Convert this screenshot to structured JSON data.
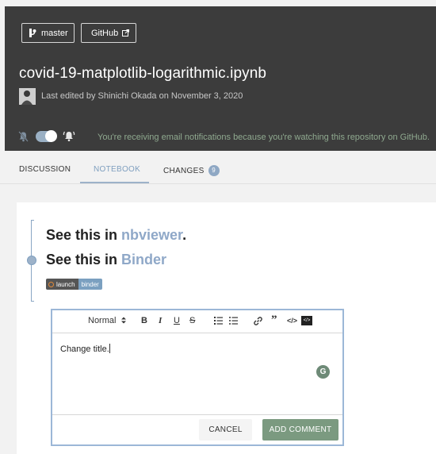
{
  "header": {
    "branch_label": "master",
    "github_label": "GitHub",
    "file_title": "covid-19-matplotlib-logarithmic.ipynb",
    "edit_meta": "Last edited by Shinichi Okada on November 3, 2020",
    "notification_text": "You're receiving email notifications because you're watching this repository on GitHub."
  },
  "tabs": [
    {
      "label": "DISCUSSION"
    },
    {
      "label": "NOTEBOOK",
      "active": true
    },
    {
      "label": "CHANGES",
      "badge": "9"
    }
  ],
  "cell": {
    "line1_prefix": "See this in ",
    "line1_link": "nbviewer",
    "line1_suffix": ".",
    "line2_prefix": "See this in ",
    "line2_link": "Binder",
    "badge_left": "launch",
    "badge_right": "binder"
  },
  "editor": {
    "format_select": "Normal",
    "bold": "B",
    "italic": "I",
    "underline": "U",
    "strike": "S",
    "quote": "”",
    "code": "</>",
    "codeblock": "</>",
    "text": "Change title.",
    "cancel_label": "CANCEL",
    "add_label": "ADD COMMENT"
  },
  "icons": {
    "branch": "branch-icon",
    "external": "external-link-icon",
    "bell_off": "bell-off-icon",
    "bell_on": "bell-ring-icon",
    "grammarly": "grammarly-icon"
  },
  "colors": {
    "accent": "#8fa8c8",
    "primary_button": "#7b9a80"
  }
}
